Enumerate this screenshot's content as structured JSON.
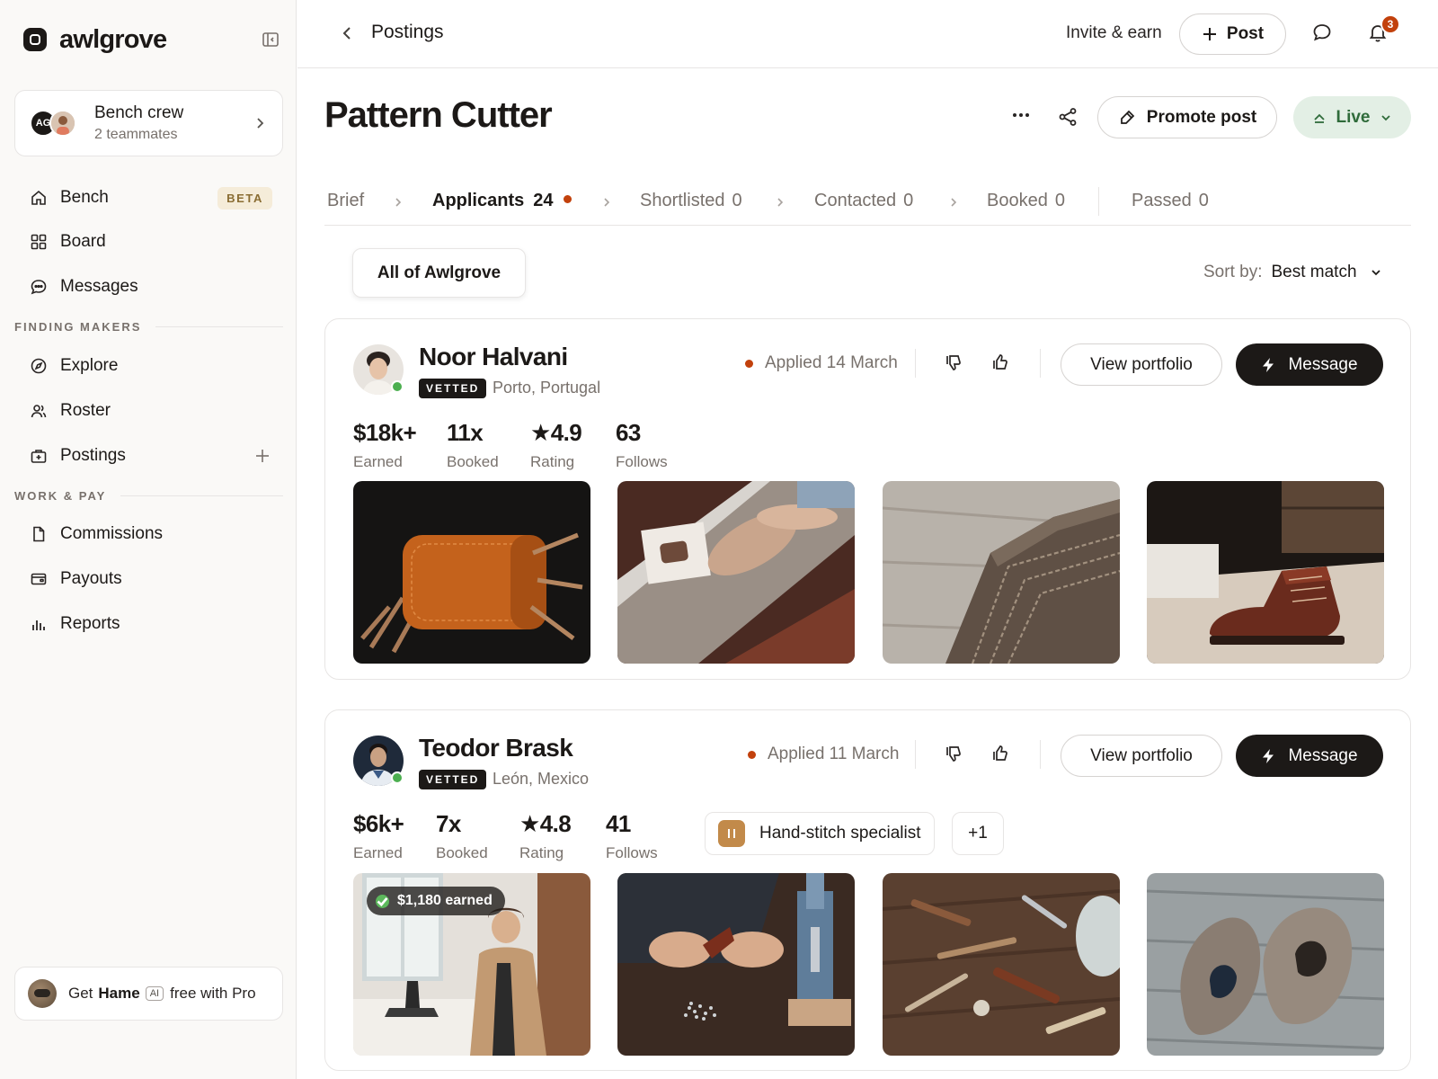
{
  "sidebar": {
    "brand": "awlgrove",
    "team": {
      "name": "Bench crew",
      "subtitle": "2 teammates",
      "initials": "AG"
    },
    "nav": [
      {
        "label": "Bench",
        "badge": "BETA"
      },
      {
        "label": "Board"
      },
      {
        "label": "Messages"
      }
    ],
    "section_finding": "FINDING MAKERS",
    "finding": [
      {
        "label": "Explore"
      },
      {
        "label": "Roster"
      },
      {
        "label": "Postings"
      }
    ],
    "section_work": "WORK & PAY",
    "work": [
      {
        "label": "Commissions"
      },
      {
        "label": "Payouts"
      },
      {
        "label": "Reports"
      }
    ],
    "promo": {
      "get": "Get",
      "product": "Hame",
      "ai": "AI",
      "rest": "free with Pro"
    }
  },
  "topbar": {
    "breadcrumb": "Postings",
    "invite": "Invite & earn",
    "post_label": "Post",
    "notification_count": "3"
  },
  "posting": {
    "title": "Pattern Cutter",
    "promote_label": "Promote post",
    "status_label": "Live",
    "status_color": "#2f6b3a"
  },
  "tabs": [
    {
      "label": "Brief"
    },
    {
      "label": "Applicants",
      "count": "24"
    },
    {
      "label": "Shortlisted",
      "count": "0"
    },
    {
      "label": "Contacted",
      "count": "0"
    },
    {
      "label": "Booked",
      "count": "0"
    },
    {
      "label": "Passed",
      "count": "0"
    }
  ],
  "filter": {
    "scope": "All of Awlgrove",
    "sort_label": "Sort by:",
    "sort_value": "Best match"
  },
  "applicants": [
    {
      "name": "Noor Halvani",
      "vetted": "VETTED",
      "location": "Porto, Portugal",
      "applied": "Applied 14 March",
      "view_label": "View portfolio",
      "message_label": "Message",
      "stats": [
        {
          "value": "$18k+",
          "label": "Earned"
        },
        {
          "value": "11x",
          "label": "Booked"
        },
        {
          "value": "★4.9",
          "label": "Rating"
        },
        {
          "value": "63",
          "label": "Follows"
        }
      ]
    },
    {
      "name": "Teodor Brask",
      "vetted": "VETTED",
      "location": "León, Mexico",
      "applied": "Applied 11 March",
      "view_label": "View portfolio",
      "message_label": "Message",
      "stats": [
        {
          "value": "$6k+",
          "label": "Earned"
        },
        {
          "value": "7x",
          "label": "Booked"
        },
        {
          "value": "★4.8",
          "label": "Rating"
        },
        {
          "value": "41",
          "label": "Follows"
        }
      ],
      "tag": "Hand-stitch specialist",
      "more_tags": "+1",
      "earned_badge": "$1,180 earned"
    }
  ],
  "colors": {
    "accent_dot": "#c2410c",
    "online": "#4caf50",
    "primary_button": "#1c1917"
  }
}
